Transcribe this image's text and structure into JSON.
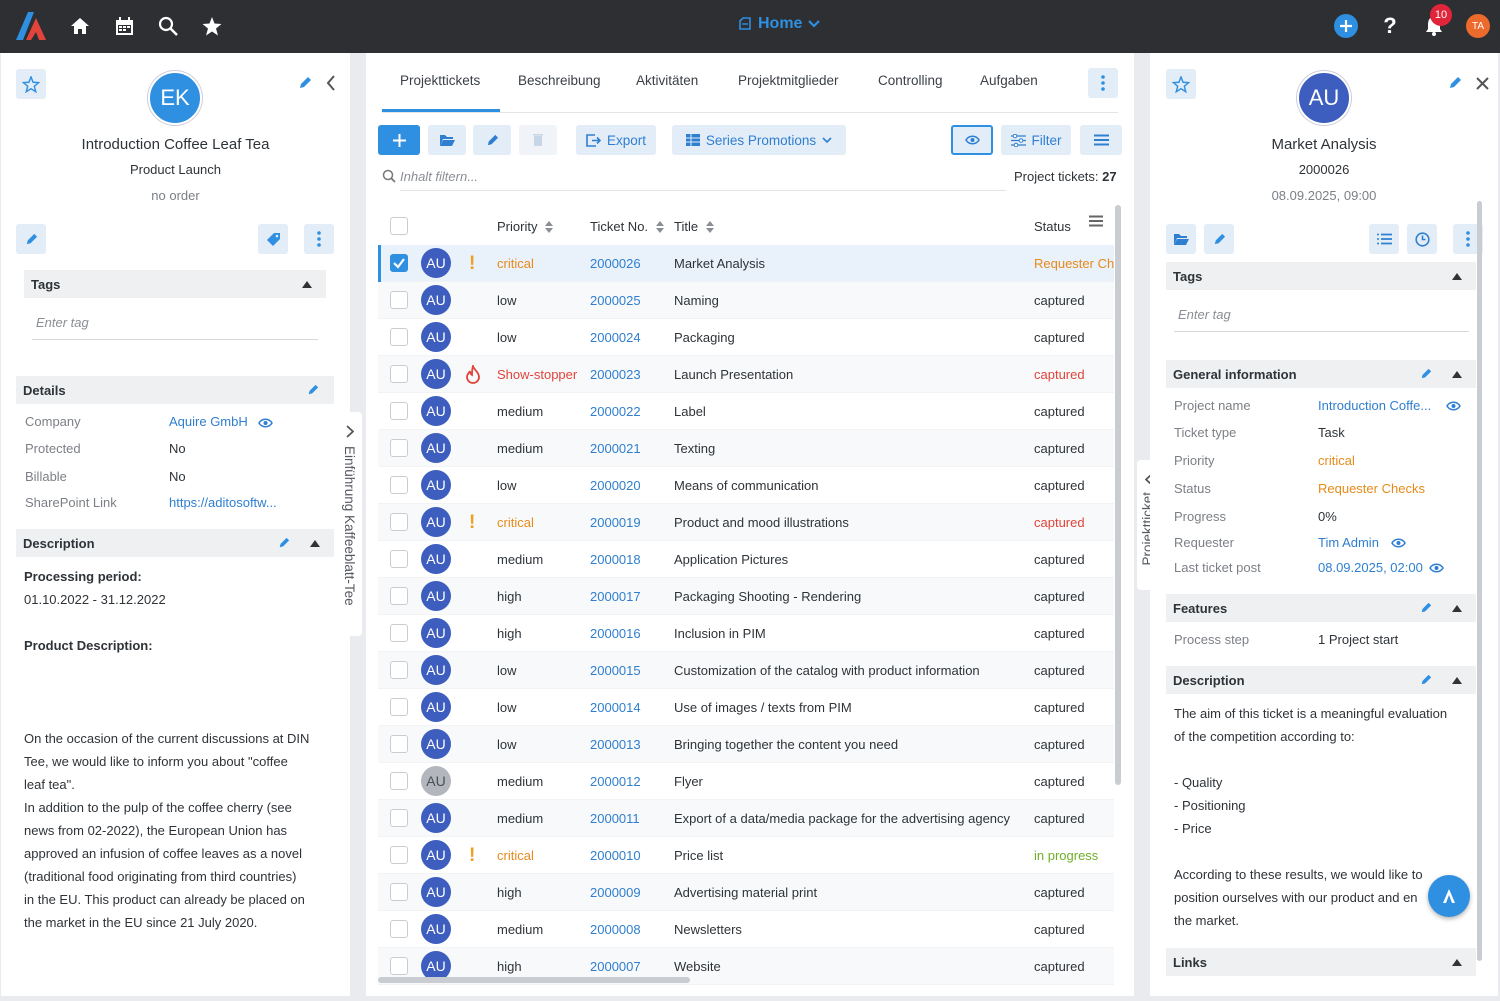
{
  "topbar": {
    "home_label": "Home",
    "notification_count": "10",
    "user_initials": "TA"
  },
  "left": {
    "avatar": "EK",
    "title": "Introduction Coffee Leaf Tea",
    "subtitle": "Product Launch",
    "order": "no order",
    "tags_header": "Tags",
    "tag_placeholder": "Enter tag",
    "details_header": "Details",
    "details": [
      {
        "label": "Company",
        "value": "Aquire GmbH"
      },
      {
        "label": "Protected",
        "value": "No"
      },
      {
        "label": "Billable",
        "value": "No"
      },
      {
        "label": "SharePoint Link",
        "value": "https://aditosoftw..."
      }
    ],
    "description_header": "Description",
    "processing_label": "Processing period:",
    "processing_value": "01.10.2022 - 31.12.2022",
    "product_desc_label": "Product Description:",
    "description_text": [
      "On the occasion of the current discussions at DIN",
      "Tee, we would like to inform you about \"coffee",
      "leaf tea\".",
      "In addition to the pulp of the coffee cherry (see",
      "news from 02-2022), the European Union has",
      "approved an infusion of coffee leaves as a novel",
      "(traditional food originating from third countries)",
      "in the EU. This product can already be placed on",
      "the market in the EU since 21 July 2020."
    ],
    "side_tab": "Einführung Kaffeeblatt-Tee"
  },
  "middle": {
    "tabs": [
      "Projekttickets",
      "Beschreibung",
      "Aktivitäten",
      "Projektmitglieder",
      "Controlling",
      "Aufgaben"
    ],
    "export_label": "Export",
    "series_label": "Series Promotions",
    "filter_label": "Filter",
    "search_placeholder": "Inhalt filtern...",
    "count_label": "Project tickets:",
    "count_value": "27",
    "columns": {
      "priority": "Priority",
      "ticket": "Ticket No.",
      "title": "Title",
      "status": "Status"
    },
    "rows": [
      {
        "avatar": "AU",
        "priority": "critical",
        "no": "2000026",
        "title": "Market Analysis",
        "status": "Requester Ch",
        "flag": "exclaim",
        "selected": true
      },
      {
        "avatar": "AU",
        "priority": "low",
        "no": "2000025",
        "title": "Naming",
        "status": "captured"
      },
      {
        "avatar": "AU",
        "priority": "low",
        "no": "2000024",
        "title": "Packaging",
        "status": "captured"
      },
      {
        "avatar": "AU",
        "priority": "Show-stopper",
        "no": "2000023",
        "title": "Launch Presentation",
        "status": "captured",
        "flag": "fire"
      },
      {
        "avatar": "AU",
        "priority": "medium",
        "no": "2000022",
        "title": "Label",
        "status": "captured"
      },
      {
        "avatar": "AU",
        "priority": "medium",
        "no": "2000021",
        "title": "Texting",
        "status": "captured"
      },
      {
        "avatar": "AU",
        "priority": "low",
        "no": "2000020",
        "title": "Means of communication",
        "status": "captured"
      },
      {
        "avatar": "AU",
        "priority": "critical",
        "no": "2000019",
        "title": "Product and mood illustrations",
        "status": "captured",
        "flag": "exclaim"
      },
      {
        "avatar": "AU",
        "priority": "medium",
        "no": "2000018",
        "title": "Application Pictures",
        "status": "captured"
      },
      {
        "avatar": "AU",
        "priority": "high",
        "no": "2000017",
        "title": "Packaging Shooting - Rendering",
        "status": "captured"
      },
      {
        "avatar": "AU",
        "priority": "high",
        "no": "2000016",
        "title": "Inclusion in PIM",
        "status": "captured"
      },
      {
        "avatar": "AU",
        "priority": "low",
        "no": "2000015",
        "title": "Customization of the catalog with product information",
        "status": "captured"
      },
      {
        "avatar": "AU",
        "priority": "low",
        "no": "2000014",
        "title": "Use of images / texts from PIM",
        "status": "captured"
      },
      {
        "avatar": "AU",
        "priority": "low",
        "no": "2000013",
        "title": "Bringing together the content you need",
        "status": "captured"
      },
      {
        "avatar": "AU",
        "priority": "medium",
        "no": "2000012",
        "title": "Flyer",
        "status": "captured",
        "grey": true
      },
      {
        "avatar": "AU",
        "priority": "medium",
        "no": "2000011",
        "title": "Export of a data/media package for the advertising agency",
        "status": "captured"
      },
      {
        "avatar": "AU",
        "priority": "critical",
        "no": "2000010",
        "title": "Price list",
        "status": "in progress",
        "flag": "exclaim"
      },
      {
        "avatar": "AU",
        "priority": "high",
        "no": "2000009",
        "title": "Advertising material print",
        "status": "captured"
      },
      {
        "avatar": "AU",
        "priority": "medium",
        "no": "2000008",
        "title": "Newsletters",
        "status": "captured"
      },
      {
        "avatar": "AU",
        "priority": "high",
        "no": "2000007",
        "title": "Website",
        "status": "captured"
      }
    ]
  },
  "right": {
    "avatar": "AU",
    "title": "Market Analysis",
    "number": "2000026",
    "date": "08.09.2025, 09:00",
    "tags_header": "Tags",
    "tag_placeholder": "Enter tag",
    "general_header": "General information",
    "general": [
      {
        "label": "Project name",
        "value": "Introduction Coffe..."
      },
      {
        "label": "Ticket type",
        "value": "Task"
      },
      {
        "label": "Priority",
        "value": "critical"
      },
      {
        "label": "Status",
        "value": "Requester Checks"
      },
      {
        "label": "Progress",
        "value": "0%"
      },
      {
        "label": "Requester",
        "value": "Tim Admin"
      },
      {
        "label": "Last ticket post",
        "value": "08.09.2025, 02:00"
      }
    ],
    "features_header": "Features",
    "features": [
      {
        "label": "Process step",
        "value": "1 Project start"
      }
    ],
    "description_header": "Description",
    "description_text": [
      "The aim of this ticket is a meaningful evaluation",
      "of the competition according to:",
      "",
      "- Quality",
      "- Positioning",
      "- Price",
      "",
      "According to these results, we would like to",
      "position ourselves with our product and en",
      "the market."
    ],
    "links_header": "Links",
    "side_tab": "Projektticket"
  },
  "colors": {
    "accent": "#2f8fe0",
    "critical": "#e88a1a",
    "showstopper": "#e0443a",
    "in_progress": "#6fae27",
    "avatar": "#3d5dbf",
    "topbar": "#2d2f33"
  }
}
